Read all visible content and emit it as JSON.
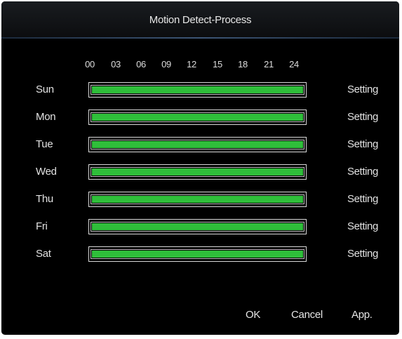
{
  "title": "Motion Detect-Process",
  "hours": [
    "00",
    "03",
    "06",
    "09",
    "12",
    "15",
    "18",
    "21",
    "24"
  ],
  "days": [
    {
      "label": "Sun",
      "action": "Setting",
      "coverage": 1.0
    },
    {
      "label": "Mon",
      "action": "Setting",
      "coverage": 1.0
    },
    {
      "label": "Tue",
      "action": "Setting",
      "coverage": 1.0
    },
    {
      "label": "Wed",
      "action": "Setting",
      "coverage": 1.0
    },
    {
      "label": "Thu",
      "action": "Setting",
      "coverage": 1.0
    },
    {
      "label": "Fri",
      "action": "Setting",
      "coverage": 1.0
    },
    {
      "label": "Sat",
      "action": "Setting",
      "coverage": 1.0
    }
  ],
  "buttons": {
    "ok": "OK",
    "cancel": "Cancel",
    "apply": "App."
  },
  "colors": {
    "active": "#2fbe3a",
    "background": "#000000",
    "text": "#e2e2e2"
  }
}
